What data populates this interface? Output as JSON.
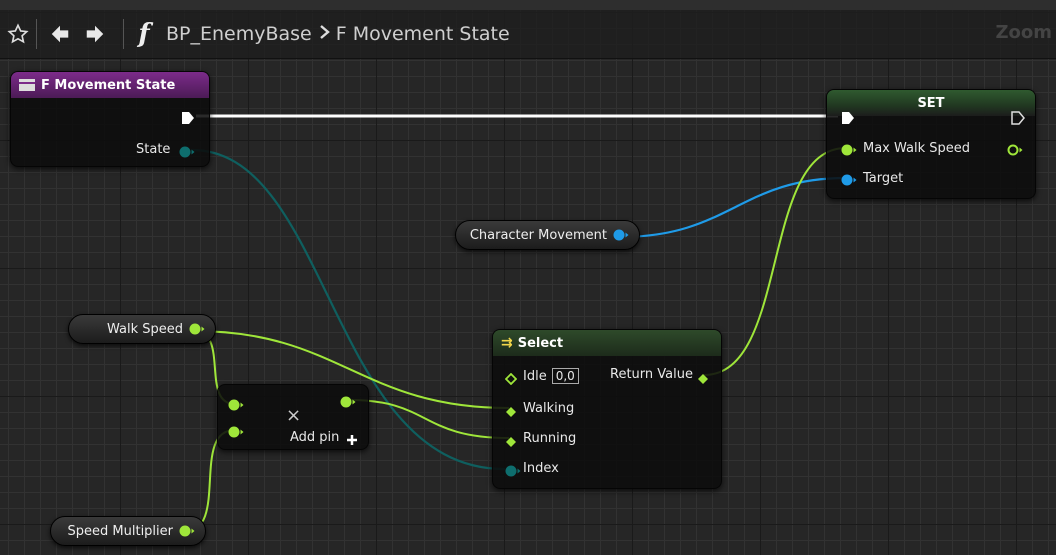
{
  "toolbar": {
    "breadcrumb_blueprint": "BP_EnemyBase",
    "breadcrumb_function": "F Movement State",
    "function_glyph": "f",
    "zoom_label": "Zoom"
  },
  "nodes": {
    "function_entry": {
      "title": "F Movement State",
      "state_label": "State"
    },
    "set_node": {
      "title": "SET",
      "max_walk_speed_label": "Max Walk Speed",
      "target_label": "Target"
    },
    "character_movement": {
      "label": "Character Movement"
    },
    "walk_speed": {
      "label": "Walk Speed"
    },
    "speed_multiplier": {
      "label": "Speed Multiplier"
    },
    "multiply_node": {
      "symbol": "×",
      "add_pin_label": "Add pin"
    },
    "select_node": {
      "title": "Select",
      "idle_label": "Idle",
      "idle_value": "0,0",
      "walking_label": "Walking",
      "running_label": "Running",
      "index_label": "Index",
      "return_label": "Return Value"
    }
  },
  "colors": {
    "float_pin": "#9fe63a",
    "object_pin": "#1f9be8",
    "enum_pin": "#0e6e6e",
    "exec_wire": "#ffffff",
    "function_header": "#6a2478"
  }
}
